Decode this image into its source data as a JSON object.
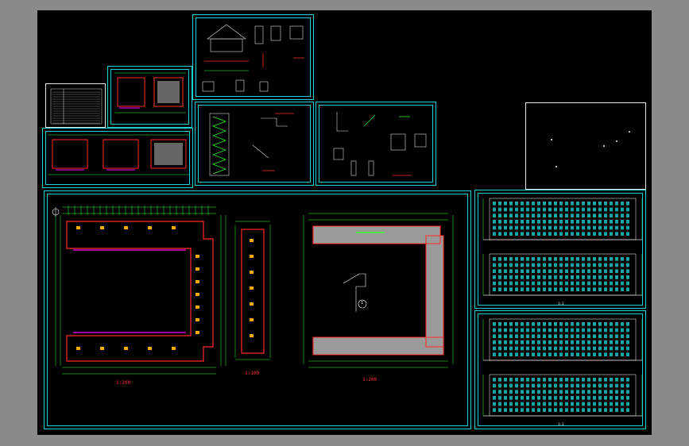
{
  "drawing": {
    "background": "#000000",
    "frame_color": "#19d3d3",
    "wall_color": "#ff2a2a",
    "dimension_color": "#33ff33",
    "annotation_color": "#ffff00",
    "fill_color": "#9a9a9a",
    "elevation_color": "#22dddd"
  },
  "captions": {
    "plan_main": "1:200",
    "plan_typical": "1:100",
    "plan_roof": "1:200",
    "elevation_south": "1:1",
    "elevation_north": "1:1",
    "detail_callout": "1"
  }
}
